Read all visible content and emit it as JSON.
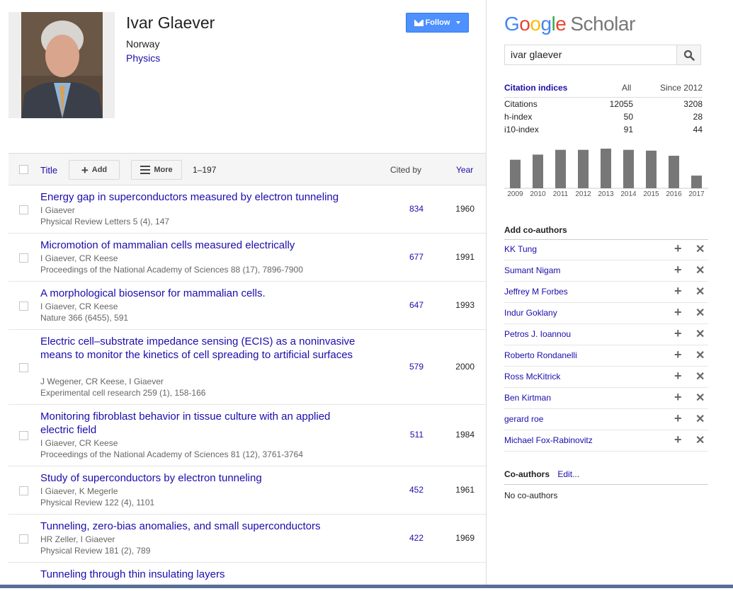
{
  "profile": {
    "name": "Ivar Glaever",
    "country": "Norway",
    "field": "Physics",
    "follow_label": "Follow"
  },
  "table": {
    "title_label": "Title",
    "add_label": "Add",
    "more_label": "More",
    "range": "1–197",
    "cited_by_label": "Cited by",
    "year_label": "Year",
    "rows": [
      {
        "title": "Energy gap in superconductors measured by electron tunneling",
        "authors": "I Giaever",
        "venue": "Physical Review Letters 5 (4), 147",
        "cited": "834",
        "year": "1960"
      },
      {
        "title": "Micromotion of mammalian cells measured electrically",
        "authors": "I Giaever, CR Keese",
        "venue": "Proceedings of the National Academy of Sciences 88 (17), 7896-7900",
        "cited": "677",
        "year": "1991"
      },
      {
        "title": "A morphological biosensor for mammalian cells.",
        "authors": "I Giaever, CR Keese",
        "venue": "Nature 366 (6455), 591",
        "cited": "647",
        "year": "1993"
      },
      {
        "title": "Electric cell–substrate impedance sensing (ECIS) as a noninvasive means to monitor the kinetics of cell spreading to artificial surfaces",
        "authors": "J Wegener, CR Keese, I Giaever",
        "venue": "Experimental cell research 259 (1), 158-166",
        "cited": "579",
        "year": "2000"
      },
      {
        "title": "Monitoring fibroblast behavior in tissue culture with an applied electric field",
        "authors": "I Giaever, CR Keese",
        "venue": "Proceedings of the National Academy of Sciences 81 (12), 3761-3764",
        "cited": "511",
        "year": "1984"
      },
      {
        "title": "Study of superconductors by electron tunneling",
        "authors": "I Giaever, K Megerle",
        "venue": "Physical Review 122 (4), 1101",
        "cited": "452",
        "year": "1961"
      },
      {
        "title": "Tunneling, zero-bias anomalies, and small superconductors",
        "authors": "HR Zeller, I Giaever",
        "venue": "Physical Review 181 (2), 789",
        "cited": "422",
        "year": "1969"
      },
      {
        "title": "Tunneling through thin insulating layers",
        "authors": "",
        "venue": "",
        "cited": "",
        "year": ""
      }
    ]
  },
  "search": {
    "logo_google": [
      "G",
      "o",
      "o",
      "g",
      "l",
      "e"
    ],
    "logo_scholar": "Scholar",
    "query": "ivar glaever"
  },
  "citation_indices": {
    "title": "Citation indices",
    "col_all": "All",
    "col_since": "Since 2012",
    "rows": [
      {
        "label": "Citations",
        "all": "12055",
        "since": "3208"
      },
      {
        "label": "h-index",
        "all": "50",
        "since": "28"
      },
      {
        "label": "i10-index",
        "all": "91",
        "since": "44"
      }
    ]
  },
  "chart_data": {
    "type": "bar",
    "categories": [
      "2009",
      "2010",
      "2011",
      "2012",
      "2013",
      "2014",
      "2015",
      "2016",
      "2017"
    ],
    "values": [
      0.72,
      0.85,
      0.97,
      0.97,
      1.0,
      0.97,
      0.95,
      0.82,
      0.32
    ],
    "title": "",
    "xlabel": "",
    "ylabel": "",
    "bar_color": "#777777"
  },
  "add_coauthors": {
    "title": "Add co-authors",
    "items": [
      "KK Tung",
      "Sumant Nigam",
      "Jeffrey M Forbes",
      "Indur Goklany",
      "Petros J. Ioannou",
      "Roberto Rondanelli",
      "Ross McKitrick",
      "Ben Kirtman",
      "gerard roe",
      "Michael Fox-Rabinovitz"
    ]
  },
  "coauthors": {
    "title": "Co-authors",
    "edit_label": "Edit...",
    "empty_text": "No co-authors"
  },
  "colors": {
    "link": "#1a0dab",
    "follow_button": "#4d90fe"
  }
}
